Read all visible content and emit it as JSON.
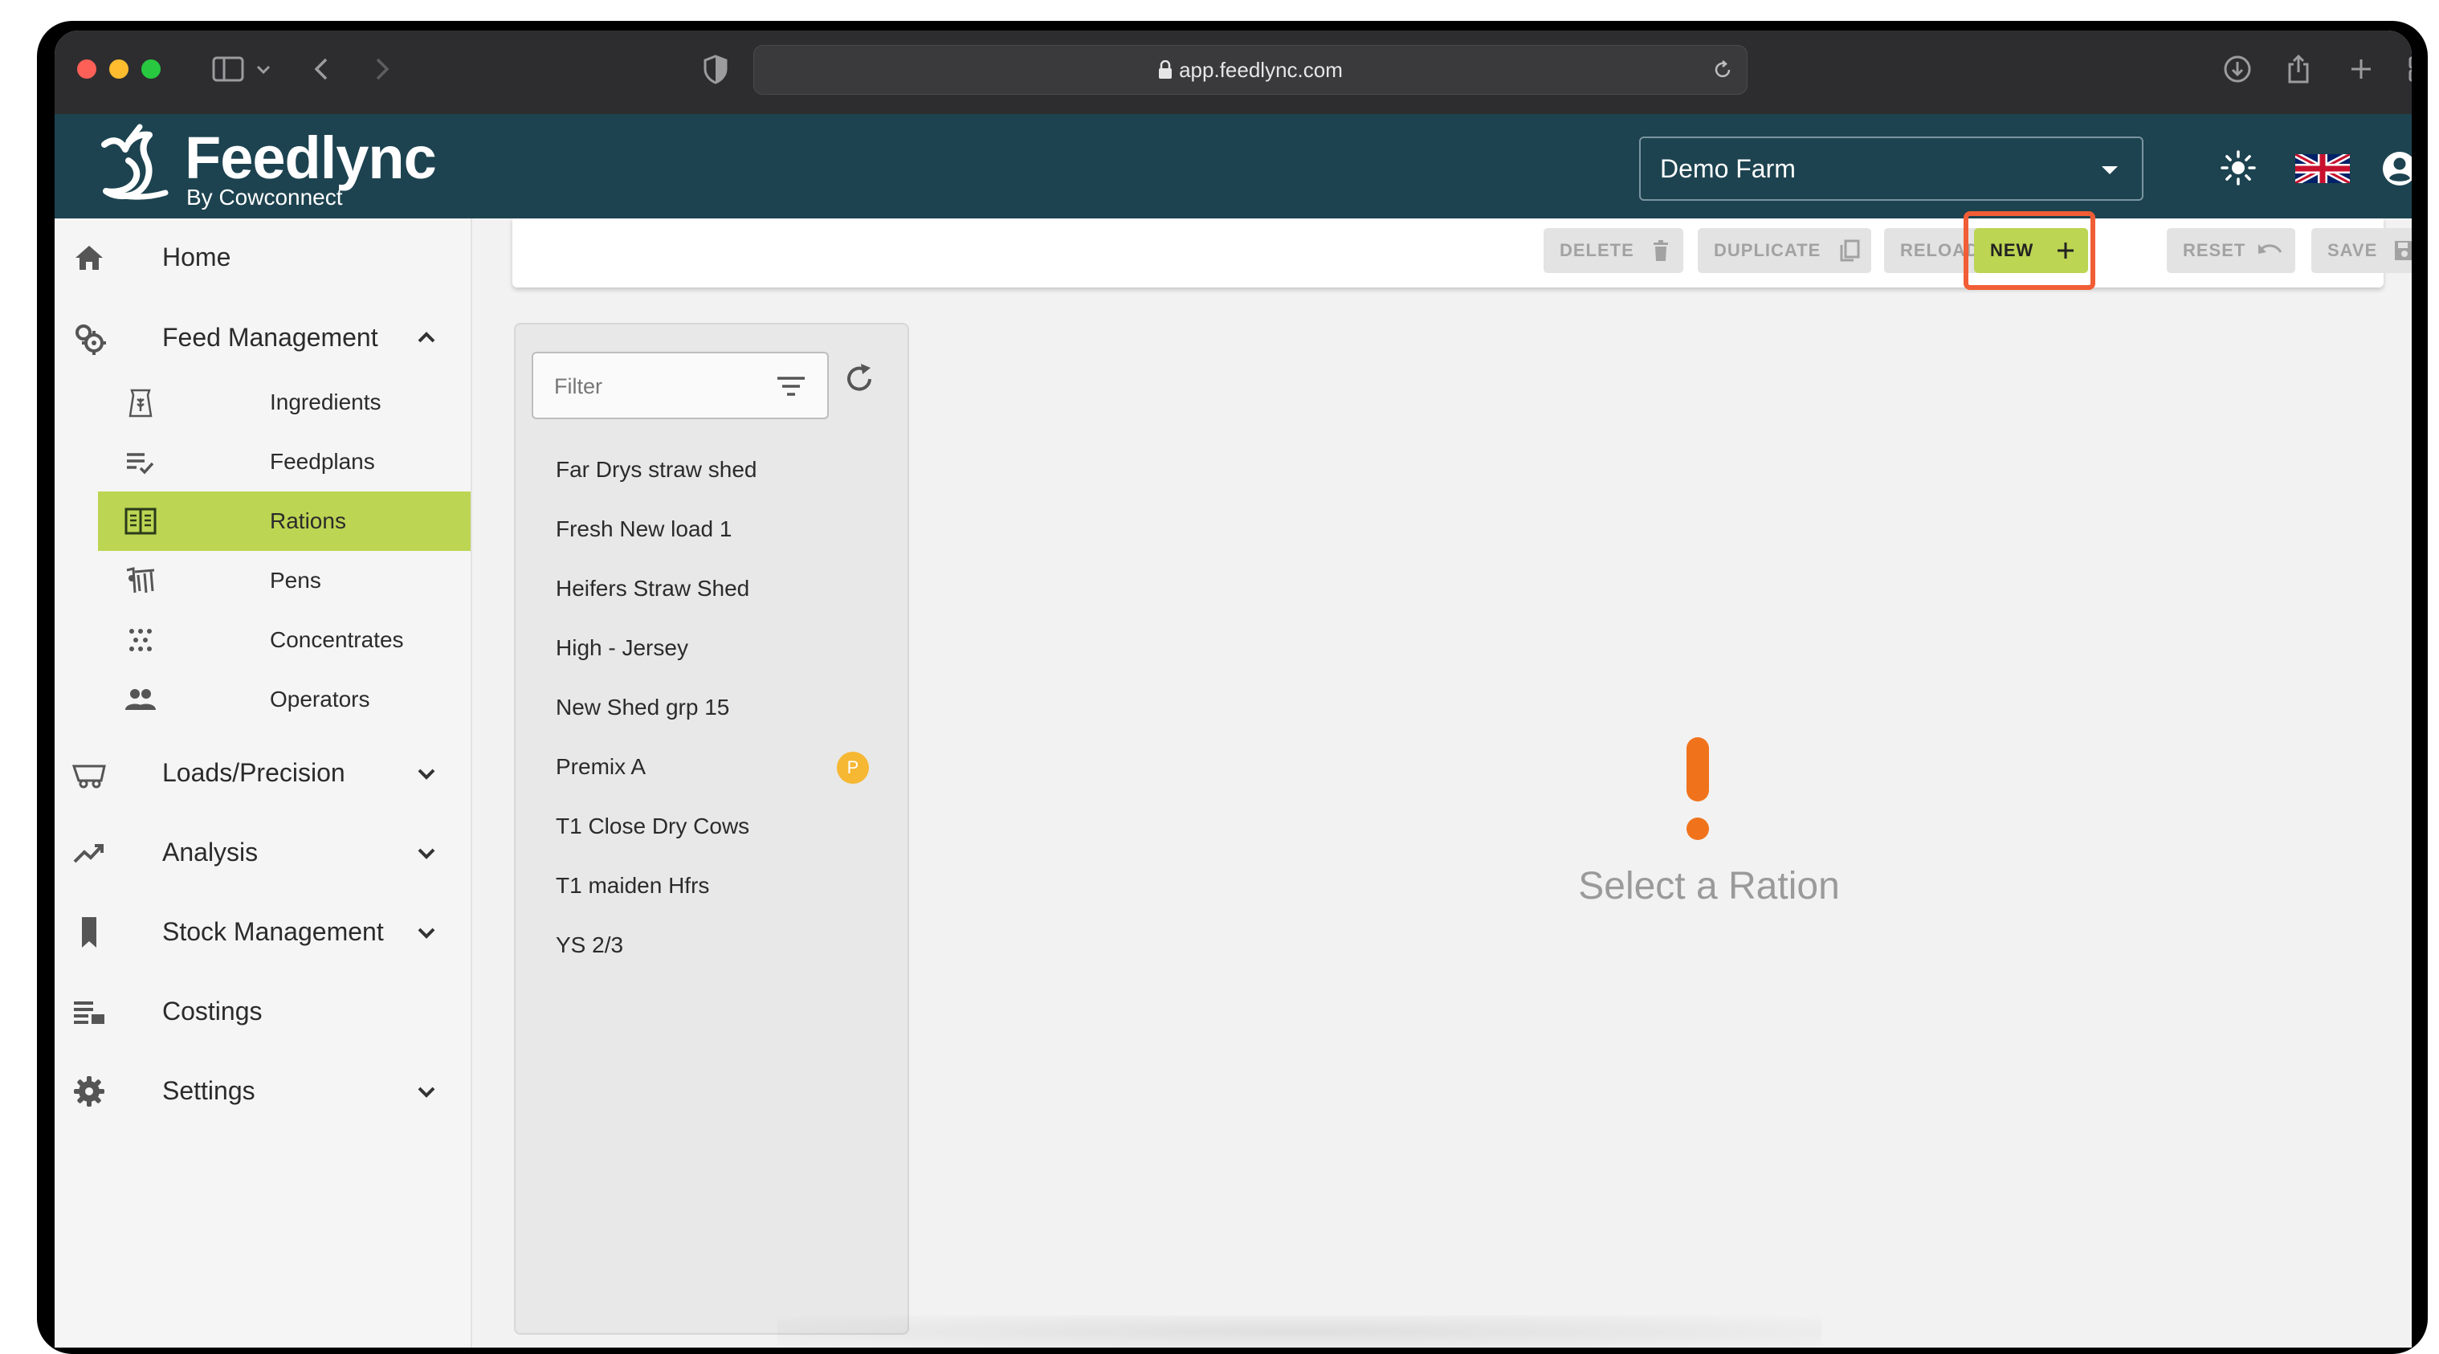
{
  "browser": {
    "url": "app.feedlync.com"
  },
  "header": {
    "logo_title": "Feedlync",
    "logo_subtitle": "By Cowconnect",
    "farm_selected": "Demo Farm",
    "accent_color": "#1d4350"
  },
  "sidebar": {
    "home": "Home",
    "feed_management": "Feed Management",
    "sub_items": {
      "ingredients": "Ingredients",
      "feedplans": "Feedplans",
      "rations": "Rations",
      "pens": "Pens",
      "concentrates": "Concentrates",
      "operators": "Operators"
    },
    "loads_precision": "Loads/Precision",
    "analysis": "Analysis",
    "stock_management": "Stock Management",
    "costings": "Costings",
    "settings": "Settings",
    "active_color": "#bcd553"
  },
  "toolbar": {
    "delete": "DELETE",
    "duplicate": "DUPLICATE",
    "reload": "RELOAD",
    "new": "NEW",
    "reset": "RESET",
    "save": "SAVE",
    "highlight_color": "#f15d35"
  },
  "list": {
    "filter_placeholder": "Filter",
    "rations": [
      {
        "name": "Far Drys straw shed",
        "badge": ""
      },
      {
        "name": "Fresh New load 1",
        "badge": ""
      },
      {
        "name": "Heifers Straw Shed",
        "badge": ""
      },
      {
        "name": "High - Jersey",
        "badge": ""
      },
      {
        "name": "New Shed grp 15",
        "badge": ""
      },
      {
        "name": "Premix A",
        "badge": "P"
      },
      {
        "name": "T1 Close Dry Cows",
        "badge": ""
      },
      {
        "name": "T1 maiden Hfrs",
        "badge": ""
      },
      {
        "name": "YS 2/3",
        "badge": ""
      }
    ]
  },
  "main": {
    "empty_message": "Select a Ration",
    "warning_color": "#f0731c"
  }
}
